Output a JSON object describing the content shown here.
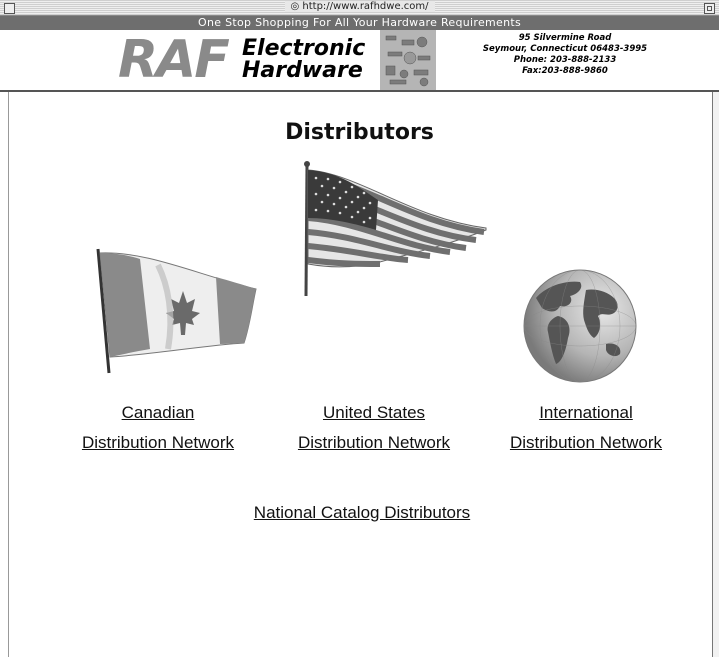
{
  "browser": {
    "url": "http://www.rafhdwe.com/"
  },
  "banner": {
    "tagline": "One Stop Shopping For All Your Hardware Requirements",
    "logo_text": "RAF",
    "company_line1": "Electronic",
    "company_line2": "Hardware",
    "address_line1": "95 Silvermine Road",
    "address_line2": "Seymour, Connecticut  06483-3995",
    "phone": "Phone: 203-888-2133",
    "fax": "Fax:203-888-9860"
  },
  "page": {
    "title": "Distributors"
  },
  "links": {
    "canadian_line1": "Canadian",
    "canadian_line2": "Distribution Network",
    "us_line1": "United States",
    "us_line2": "Distribution Network",
    "intl_line1": "International",
    "intl_line2": "Distribution Network",
    "national": "National Catalog Distributors"
  },
  "icons": {
    "canada": "canada-flag-icon",
    "usa": "usa-flag-icon",
    "globe": "globe-icon"
  }
}
